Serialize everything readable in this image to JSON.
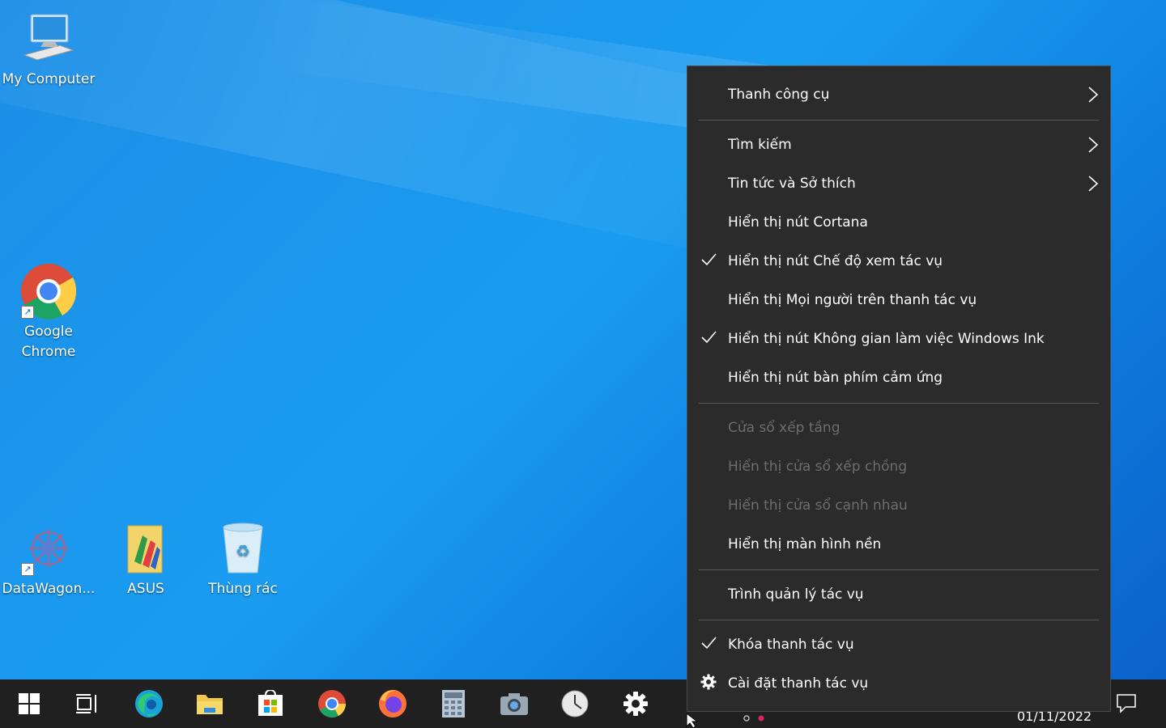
{
  "desktop_icons": [
    {
      "label": "My Computer",
      "icon": "computer-icon"
    },
    {
      "label": "Google\nChrome",
      "icon": "chrome-icon"
    },
    {
      "label": "DataWagon...",
      "icon": "datawagon-icon"
    },
    {
      "label": "ASUS",
      "icon": "folder-icon"
    },
    {
      "label": "Thùng rác",
      "icon": "recycle-bin-icon"
    }
  ],
  "menu": {
    "items": {
      "toolbars": "Thanh công cụ",
      "search": "Tìm kiếm",
      "news": "Tin tức và Sở thích",
      "cortana": "Hiển thị nút Cortana",
      "task_view": "Hiển thị nút Chế độ xem tác vụ",
      "people": "Hiển thị Mọi người trên thanh tác vụ",
      "windows_ink": "Hiển thị nút Không gian làm việc Windows Ink",
      "touch_keyboard": "Hiển thị nút bàn phím cảm ứng",
      "cascade": "Cửa sổ xếp tầng",
      "stacked": "Hiển thị cửa sổ xếp chồng",
      "side_by_side": "Hiển thị cửa sổ cạnh nhau",
      "show_desktop": "Hiển thị màn hình nền",
      "task_manager": "Trình quản lý tác vụ",
      "lock_taskbar": "Khóa thanh tác vụ",
      "taskbar_settings": "Cài đặt thanh tác vụ"
    },
    "checked": [
      "task_view",
      "windows_ink",
      "lock_taskbar"
    ],
    "disabled": [
      "cascade",
      "stacked",
      "side_by_side"
    ]
  },
  "taskbar": {
    "apps": [
      "start-icon",
      "task-view-icon",
      "edge-icon",
      "file-explorer-icon",
      "store-icon",
      "chrome-icon",
      "firefox-icon",
      "calculator-icon",
      "camera-icon",
      "clock-icon",
      "settings-icon"
    ],
    "date": "01/11/2022"
  },
  "colors": {
    "menu_bg": "#2b2b2b",
    "taskbar_bg": "#202020",
    "desktop_accent": "#1a9cf0"
  }
}
